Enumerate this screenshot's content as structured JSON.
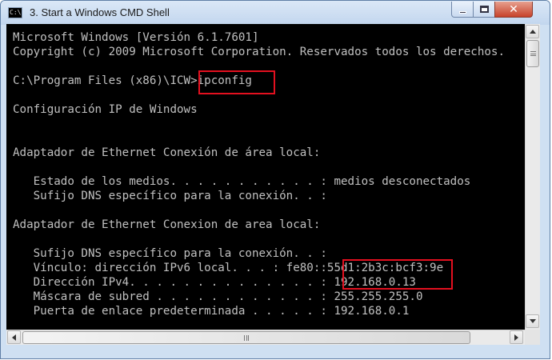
{
  "window": {
    "title": "3. Start a Windows CMD Shell",
    "controls": {
      "minimize": "minimize",
      "maximize": "maximize",
      "close": "✕"
    }
  },
  "console": {
    "lines": [
      "Microsoft Windows [Versión 6.1.7601]",
      "Copyright (c) 2009 Microsoft Corporation. Reservados todos los derechos.",
      "",
      "C:\\Program Files (x86)\\ICW>ipconfig",
      "",
      "Configuración IP de Windows",
      "",
      "",
      "Adaptador de Ethernet Conexión de área local:",
      "",
      "   Estado de los medios. . . . . . . . . . . : medios desconectados",
      "   Sufijo DNS específico para la conexión. . :",
      "",
      "Adaptador de Ethernet Conexion de area local:",
      "",
      "   Sufijo DNS específico para la conexión. . :",
      "   Vínculo: dirección IPv6 local. . . : fe80::55d1:2b3c:bcf3:9e",
      "   Dirección IPv4. . . . . . . . . . . . . . : 192.168.0.13",
      "   Máscara de subred . . . . . . . . . . . . : 255.255.255.0",
      "   Puerta de enlace predeterminada . . . . . : 192.168.0.1"
    ]
  },
  "colors": {
    "console_bg": "#000000",
    "console_text": "#c0c0c0",
    "highlight": "#e3101f"
  },
  "icons": {
    "app": "cmd-icon",
    "scroll_up": "arrow-up-icon",
    "scroll_down": "arrow-down-icon",
    "scroll_left": "arrow-left-icon",
    "scroll_right": "arrow-right-icon"
  }
}
